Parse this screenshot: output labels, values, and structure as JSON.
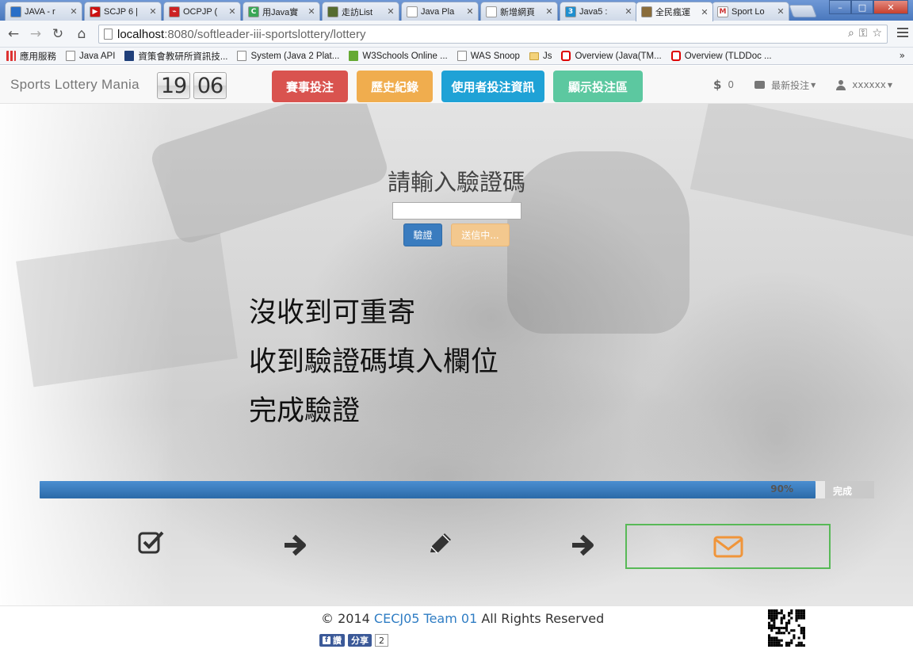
{
  "browser": {
    "tabs": [
      {
        "title": "JAVA - r",
        "fav_color": "#2a6fc7",
        "fav_glyph": ""
      },
      {
        "title": "SCJP 6 |",
        "fav_color": "#cc1111",
        "fav_glyph": "▶"
      },
      {
        "title": "OCPJP (",
        "fav_color": "#cc2222",
        "fav_glyph": "⌁"
      },
      {
        "title": "用Java實",
        "fav_color": "#3aa757",
        "fav_glyph": "C"
      },
      {
        "title": "走訪List",
        "fav_color": "#556b2f",
        "fav_glyph": ""
      },
      {
        "title": "Java Pla",
        "fav_color": "#ffffff",
        "fav_glyph": ""
      },
      {
        "title": "新增網頁",
        "fav_color": "#ffffff",
        "fav_glyph": ""
      },
      {
        "title": "Java5 :",
        "fav_color": "#1f8fcf",
        "fav_glyph": "3"
      },
      {
        "title": "全民瘋運",
        "fav_color": "#8a6d3b",
        "fav_glyph": ""
      },
      {
        "title": "Sport Lo",
        "fav_color": "#ffffff",
        "fav_glyph": "M"
      }
    ],
    "url_host": "localhost",
    "url_path": ":8080/softleader-iii-sportslottery/lottery",
    "bookmarks": [
      {
        "label": "應用服務",
        "icon": "apps-icon"
      },
      {
        "label": "Java API",
        "icon": "page-icon"
      },
      {
        "label": "資策會教研所資訊技...",
        "icon": "edu-icon"
      },
      {
        "label": "System (Java 2 Plat...",
        "icon": "page-icon"
      },
      {
        "label": "W3Schools Online ...",
        "icon": "w3-icon"
      },
      {
        "label": "WAS Snoop",
        "icon": "page-icon"
      },
      {
        "label": "Js",
        "icon": "folder-icon"
      },
      {
        "label": "Overview (Java(TM...",
        "icon": "oracle-icon"
      },
      {
        "label": "Overview (TLDDoc ...",
        "icon": "oracle-icon"
      }
    ],
    "bookmarks_more": "»"
  },
  "navbar": {
    "brand": "Sports Lottery Mania",
    "clock_hours": "19",
    "clock_minutes": "06",
    "buttons": [
      {
        "label": "賽事投注",
        "color": "#d9534f"
      },
      {
        "label": "歷史紀錄",
        "color": "#f0ad4e"
      },
      {
        "label": "使用者投注資訊",
        "color": "#1fa2d6"
      },
      {
        "label": "顯示投注區",
        "color": "#5cc8a0"
      }
    ],
    "balance": "0",
    "latest_bets": "最新投注",
    "username": "xxxxxx"
  },
  "verify": {
    "title": "請輸入驗證碼",
    "input_value": "",
    "verify_button": "驗證",
    "sending_button": "送信中..."
  },
  "steps": [
    "沒收到可重寄",
    "收到驗證碼填入欄位",
    "完成驗證"
  ],
  "progress": {
    "percent": 90,
    "percent_label": "90%",
    "done_label": "完成"
  },
  "icons": [
    "check-square-icon",
    "arrow-right-icon",
    "pencil-icon",
    "arrow-right-icon",
    "envelope-icon"
  ],
  "footer": {
    "copy_symbol": "©",
    "year": "2014",
    "team": "CECJ05 Team 01",
    "rights": "All Rights Reserved",
    "fb_like": "讚",
    "fb_share": "分享",
    "share_count": "2"
  },
  "colors": {
    "accent_blue": "#2f7dc4",
    "progress_bar": "#2b6aa8",
    "mail_border": "#58b957",
    "mail_icon": "#f0953a"
  }
}
